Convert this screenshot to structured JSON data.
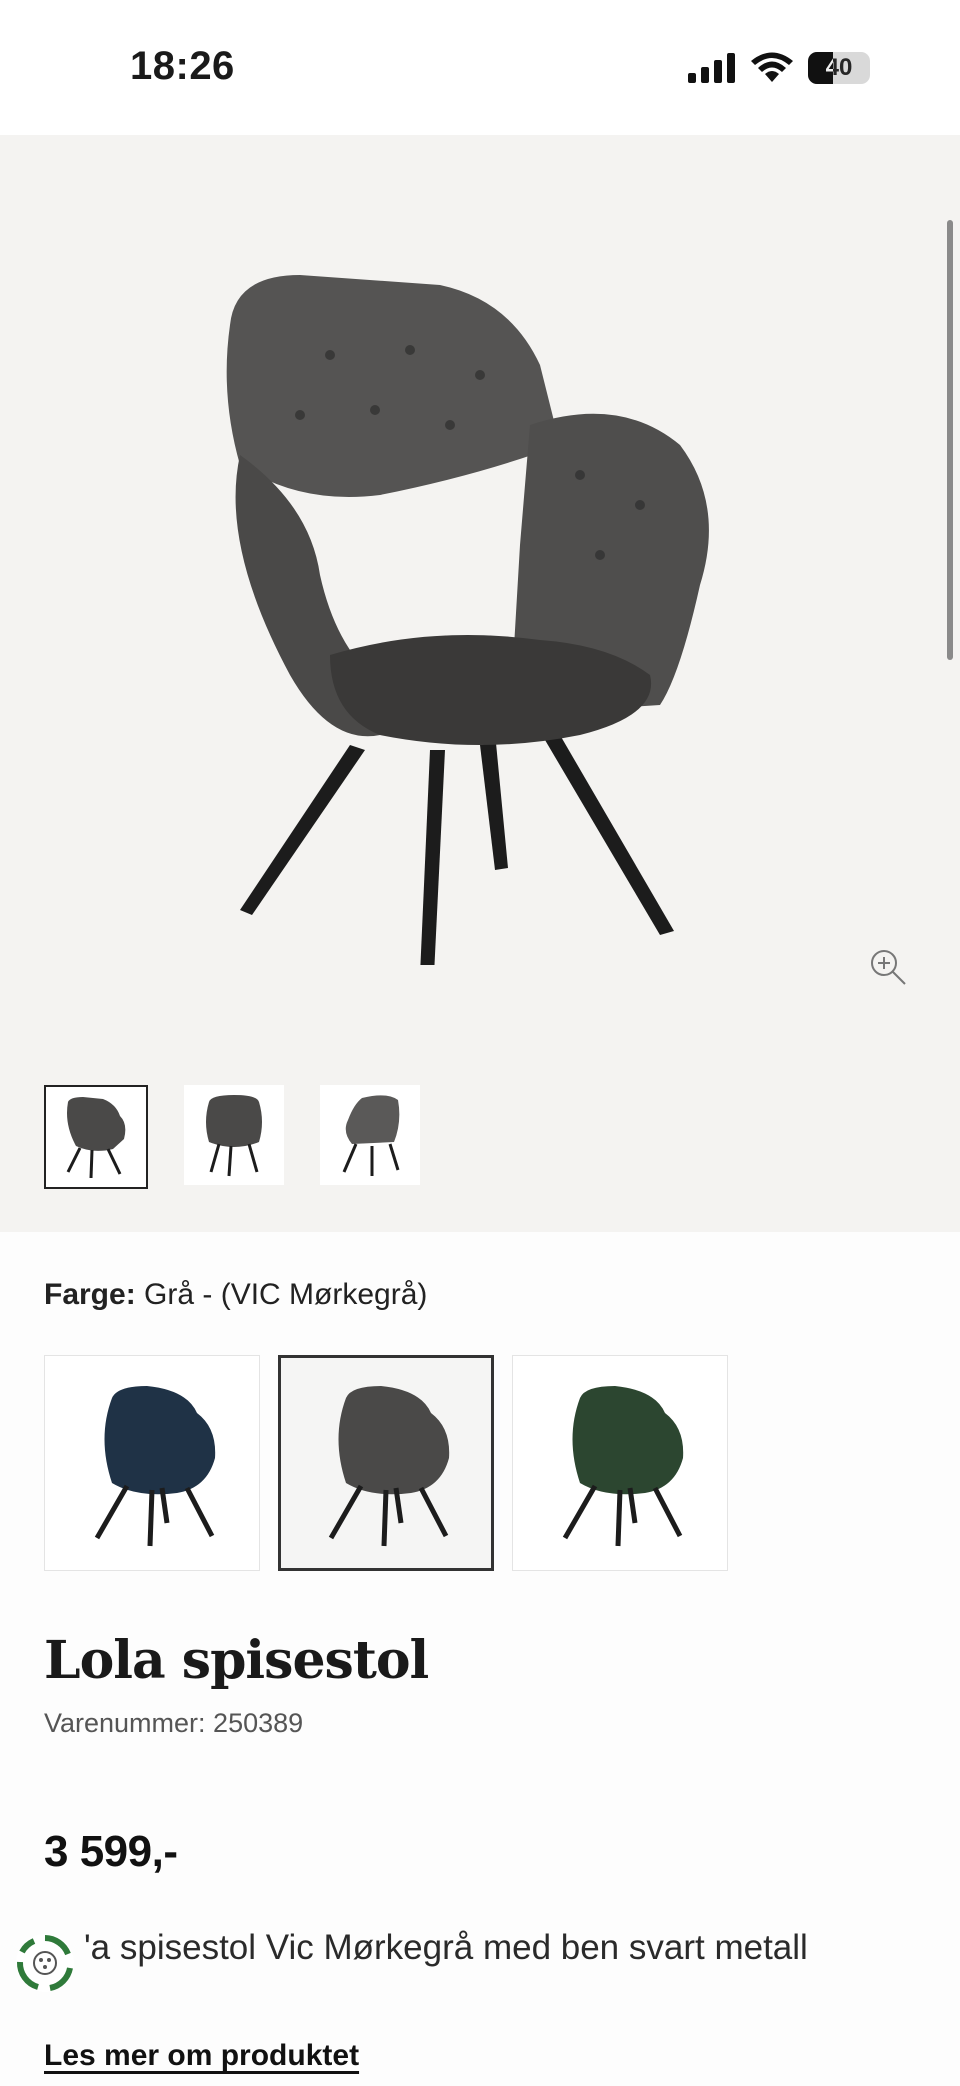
{
  "status_bar": {
    "time": "18:26",
    "battery": "40"
  },
  "gallery": {
    "main_image_alt": "grey velvet chair",
    "thumbnails": [
      {
        "name": "front-angle"
      },
      {
        "name": "front"
      },
      {
        "name": "back"
      }
    ]
  },
  "color": {
    "label": "Farge:",
    "value": "Grå - (VIC Mørkegrå)",
    "options": [
      {
        "name": "blue",
        "color": "#1f3246",
        "selected": false
      },
      {
        "name": "grey",
        "color": "#4a4948",
        "selected": true
      },
      {
        "name": "green",
        "color": "#2c4630",
        "selected": false
      }
    ]
  },
  "product": {
    "title": "Lola spisestol",
    "sku": "Varenummer: 250389",
    "price": "3 599,-",
    "description": "'a spisestol Vic Mørkegrå med ben svart metall",
    "read_more": "Les mer om produktet"
  }
}
